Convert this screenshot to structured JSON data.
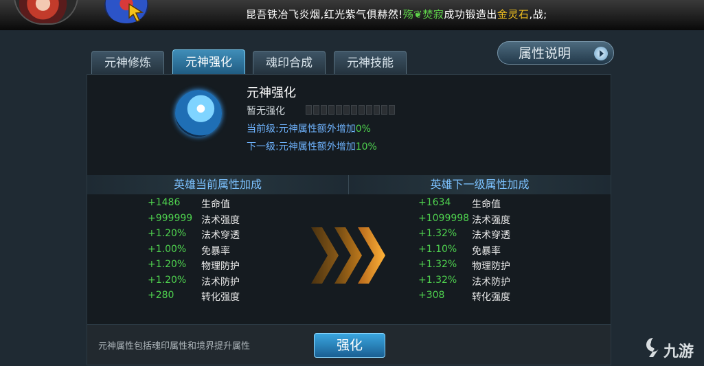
{
  "ticker": {
    "part1": "昆吾铁冶飞炎烟,红光紫气俱赫然!",
    "player": "殇❦焚寂",
    "part2": "成功锻造出",
    "item": "金灵石",
    "part3": ",战;"
  },
  "tabs": [
    {
      "label": "元神修炼",
      "active": false
    },
    {
      "label": "元神强化",
      "active": true
    },
    {
      "label": "魂印合成",
      "active": false
    },
    {
      "label": "元神技能",
      "active": false
    }
  ],
  "info_button": {
    "label": "属性说明"
  },
  "skill": {
    "title": "元神强化",
    "status": "暂无强化",
    "progress_segments": 12,
    "progress_filled": 0,
    "current": {
      "text": "当前级:元神属性额外增加",
      "pct": "0%"
    },
    "next": {
      "text": "下一级:元神属性额外增加",
      "pct": "10%"
    }
  },
  "current_header": "英雄当前属性加成",
  "next_header": "英雄下一级属性加成",
  "current_stats": [
    {
      "value": "+1486",
      "label": "生命值"
    },
    {
      "value": "+999999",
      "label": "法术强度"
    },
    {
      "value": "+1.20%",
      "label": "法术穿透"
    },
    {
      "value": "+1.00%",
      "label": "免暴率"
    },
    {
      "value": "+1.20%",
      "label": "物理防护"
    },
    {
      "value": "+1.20%",
      "label": "法术防护"
    },
    {
      "value": "+280",
      "label": "转化强度"
    }
  ],
  "next_stats": [
    {
      "value": "+1634",
      "label": "生命值"
    },
    {
      "value": "+1099998",
      "label": "法术强度"
    },
    {
      "value": "+1.32%",
      "label": "法术穿透"
    },
    {
      "value": "+1.10%",
      "label": "免暴率"
    },
    {
      "value": "+1.32%",
      "label": "物理防护"
    },
    {
      "value": "+1.32%",
      "label": "法术防护"
    },
    {
      "value": "+308",
      "label": "转化强度"
    }
  ],
  "bottom": {
    "note": "元神属性包括魂印属性和境界提升属性",
    "button": "强化"
  },
  "watermark": "九游",
  "colors": {
    "accent": "#3aa6e0",
    "positive": "#4fd34f",
    "highlight": "#f4c21e"
  }
}
